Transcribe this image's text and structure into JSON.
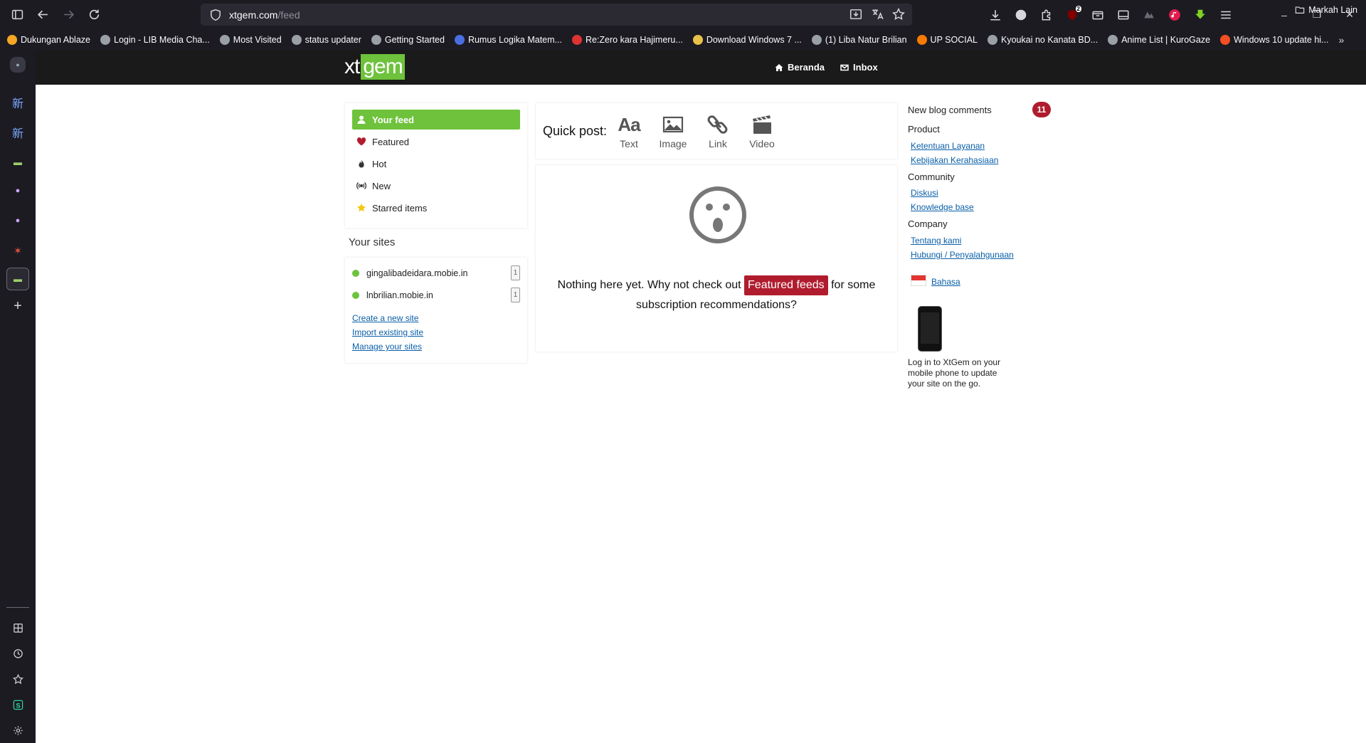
{
  "browser": {
    "url_host": "xtgem.com",
    "url_path": "/feed",
    "notif_badge": "2",
    "bookmarks": [
      {
        "label": "Dukungan Ablaze",
        "color": "#f5a623"
      },
      {
        "label": "Login - LIB Media Cha...",
        "color": "#9aa0a6"
      },
      {
        "label": "Most Visited",
        "color": "#9aa0a6"
      },
      {
        "label": "status updater",
        "color": "#9aa0a6"
      },
      {
        "label": "Getting Started",
        "color": "#9aa0a6"
      },
      {
        "label": "Rumus Logika Matem...",
        "color": "#4a6ee0"
      },
      {
        "label": "Re:Zero kara Hajimeru...",
        "color": "#d33"
      },
      {
        "label": "Download Windows 7 ...",
        "color": "#e8c14a"
      },
      {
        "label": "(1) Liba Natur Brilian",
        "color": "#9aa0a6"
      },
      {
        "label": "UP SOCIAL",
        "color": "#f57c00"
      },
      {
        "label": "Kyoukai no Kanata BD...",
        "color": "#9aa0a6"
      },
      {
        "label": "Anime List | KuroGaze",
        "color": "#9aa0a6"
      },
      {
        "label": "Windows 10 update hi...",
        "color": "#f25022"
      }
    ],
    "other_bookmarks": "Markah Lain"
  },
  "sidebar_tabs": [
    "新",
    "新"
  ],
  "site": {
    "logo_left": "xt",
    "logo_right": "gem",
    "nav": {
      "home": "Beranda",
      "inbox": "Inbox"
    }
  },
  "left": {
    "menu": [
      {
        "label": "Your feed"
      },
      {
        "label": "Featured"
      },
      {
        "label": "Hot"
      },
      {
        "label": "New"
      },
      {
        "label": "Starred items"
      }
    ],
    "sites_title": "Your sites",
    "sites": [
      {
        "name": "gingalibadeidara.mobie.in",
        "count": "1"
      },
      {
        "name": "lnbrilian.mobie.in",
        "count": "1"
      }
    ],
    "links": {
      "create": "Create a new site",
      "import": "Import existing site",
      "manage": "Manage your sites"
    }
  },
  "center": {
    "quick_post_label": "Quick post:",
    "options": {
      "text_icon": "Aa",
      "text": "Text",
      "image": "Image",
      "link": "Link",
      "video": "Video"
    },
    "empty_before": "Nothing here yet. Why not check out",
    "featured_button": "Featured feeds",
    "empty_after": "for some",
    "empty_line2": "subscription recommendations?"
  },
  "right": {
    "comments_title": "New blog comments",
    "comments_count": "11",
    "product_title": "Product",
    "product_links": [
      "Ketentuan Layanan",
      "Kebijakan Kerahasiaan"
    ],
    "community_title": "Community",
    "community_links": [
      "Diskusi",
      "Knowledge base"
    ],
    "company_title": "Company",
    "company_links": [
      "Tentang kami",
      "Hubungi / Penyalahgunaan"
    ],
    "language": "Bahasa",
    "phone_text": "Log in to XtGem on your mobile phone to update your site on the go."
  },
  "colors": {
    "accent_green": "#6ec23c",
    "accent_red": "#b01c2e",
    "link_blue": "#0a5fa8"
  }
}
